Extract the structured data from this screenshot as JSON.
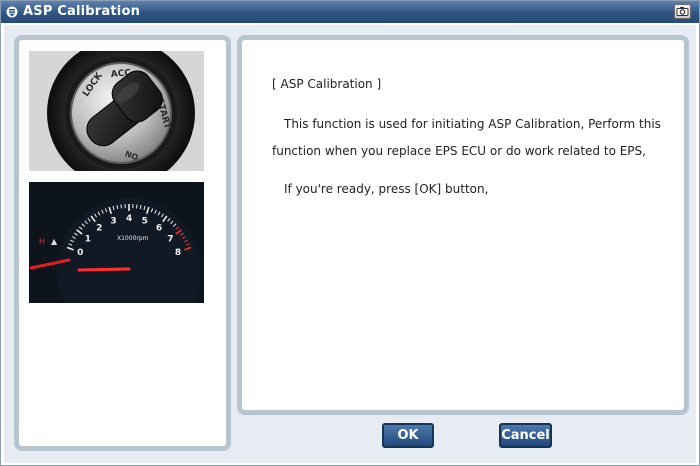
{
  "window": {
    "title": "ASP Calibration",
    "title_icon": "down-arrow-icon",
    "camera_icon": "camera-icon"
  },
  "images": {
    "ignition_switch": {
      "labels": [
        "LOCK",
        "ACC",
        "START",
        "ON"
      ]
    },
    "tachometer": {
      "label": "X1000rpm",
      "ticks": [
        "0",
        "1",
        "2",
        "3",
        "4",
        "5",
        "6",
        "7",
        "8"
      ]
    }
  },
  "message": {
    "heading": "[ ASP Calibration ]",
    "line1": "This function is used for initiating ASP Calibration, Perform this",
    "line2": "function when you replace EPS ECU or do work related to EPS,",
    "line3": "If you're ready, press [OK] button,"
  },
  "buttons": {
    "ok": "OK",
    "cancel": "Cancel"
  },
  "colors": {
    "titlebar": "#2e5582",
    "panel_border": "#b9c4d1",
    "button": "#22497a",
    "background": "#e7ecf2"
  }
}
